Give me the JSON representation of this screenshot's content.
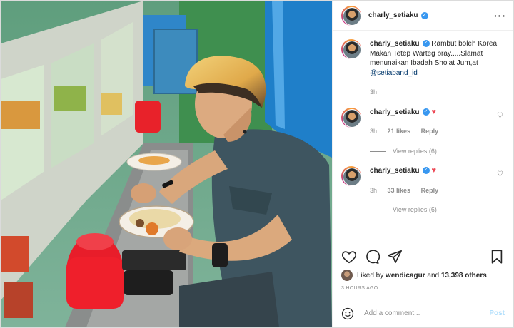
{
  "post": {
    "author": "charly_setiaku",
    "more_icon": "more-horizontal-icon",
    "caption_user": "charly_setiaku",
    "caption_text": "Rambut boleh Korea Makan Tetep Warteg bray.....Slamat menunaikan Ibadah Sholat Jum,at",
    "caption_mention": "@setiaband_id",
    "caption_time": "3h"
  },
  "comments": [
    {
      "user": "charly_setiaku",
      "time": "3h",
      "likes": "21 likes",
      "reply": "Reply",
      "view_replies": "View replies (6)"
    },
    {
      "user": "charly_setiaku",
      "time": "3h",
      "likes": "33 likes",
      "reply": "Reply",
      "view_replies": "View replies (6)"
    }
  ],
  "actions": {
    "liked_by_prefix": "Liked by",
    "liked_by_user": "wendicagur",
    "liked_by_and": "and",
    "liked_by_count": "13,398 others",
    "time_ago": "3 HOURS AGO"
  },
  "add_comment": {
    "placeholder": "Add a comment...",
    "post_label": "Post"
  },
  "colors": {
    "verified": "#3897f0",
    "heart_red": "#ed4956",
    "mention": "#00376b",
    "post_disabled": "#b2dffc"
  }
}
